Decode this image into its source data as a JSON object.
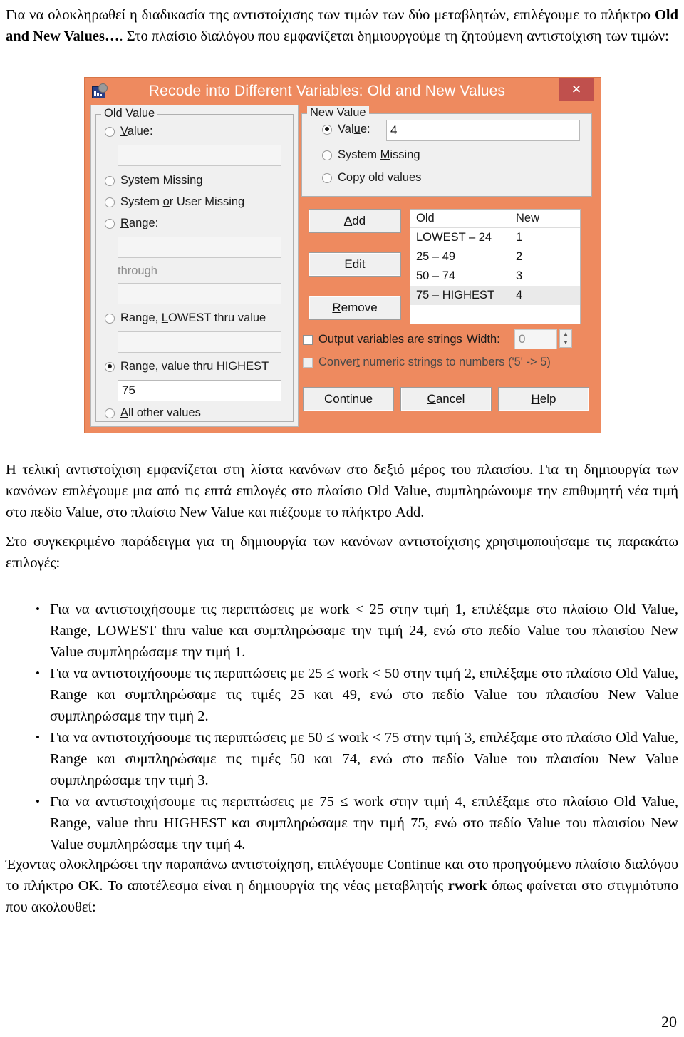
{
  "document": {
    "intro_paragraph_part1": "Για να ολοκληρωθεί η διαδικασία της αντιστοίχισης των τιμών των δύο μεταβλητών, επιλέγουμε το πλήκτρο ",
    "intro_paragraph_bold": "Old and New Values…",
    "intro_paragraph_part2": ". Στο πλαίσιο διαλόγου που εμφανίζεται δημιουργούμε τη ζητούμενη αντιστοίχιση των τιμών:",
    "mid_paragraph_1": "Η τελική αντιστοίχιση εμφανίζεται στη λίστα κανόνων στο δεξιό μέρος του πλαισίου. Για τη δημιουργία των κανόνων επιλέγουμε μια από τις επτά επιλογές στο πλαίσιο Old Value, συμπληρώνουμε την επιθυμητή νέα τιμή στο πεδίο Value, στο πλαίσιο New Value και πιέζουμε το πλήκτρο Add.",
    "mid_paragraph_2": "Στο συγκεκριμένο παράδειγμα για τη δημιουργία των κανόνων αντιστοίχισης χρησιμοποιήσαμε τις παρακάτω επιλογές:",
    "bullets": [
      "Για να αντιστοιχήσουμε τις περιπτώσεις με  work < 25 στην τιμή 1, επιλέξαμε στο πλαίσιο Old Value, Range, LOWEST thru value και συμπληρώσαμε την τιμή 24, ενώ στο πεδίο Value του πλαισίου New Value συμπληρώσαμε την τιμή 1.",
      "Για να αντιστοιχήσουμε τις περιπτώσεις με  25 ≤ work < 50 στην τιμή 2, επιλέξαμε στο πλαίσιο Old Value, Range και συμπληρώσαμε τις τιμές 25 και 49, ενώ στο πεδίο Value του πλαισίου New Value συμπληρώσαμε την τιμή 2.",
      "Για να αντιστοιχήσουμε τις περιπτώσεις με  50 ≤ work < 75 στην τιμή 3, επιλέξαμε στο πλαίσιο Old Value, Range και συμπληρώσαμε τις τιμές 50 και 74, ενώ στο πεδίο Value του πλαισίου New Value συμπληρώσαμε την τιμή 3.",
      "Για να αντιστοιχήσουμε τις περιπτώσεις με  75 ≤ work στην τιμή 4, επιλέξαμε στο πλαίσιο Old Value, Range, value thru HIGHEST και συμπληρώσαμε την τιμή 75, ενώ στο πεδίο Value του πλαισίου New Value συμπληρώσαμε την τιμή 4."
    ],
    "bullet_marker": "•",
    "closing_paragraph_part1": "Έχοντας ολοκληρώσει την παραπάνω αντιστοίχηση, επιλέγουμε Continue και στο προηγούμενο πλαίσιο διαλόγου το πλήκτρο ΟΚ. Το αποτέλεσμα είναι η δημιουργία της νέας μεταβλητής ",
    "closing_paragraph_bold": "rwork",
    "closing_paragraph_part2": " όπως φαίνεται στο στιγμιότυπο που ακολουθεί:",
    "page_number": "20"
  },
  "dialog": {
    "title": "Recode into Different Variables: Old and New Values",
    "close_label": "✕",
    "titlebar_color": "#ee8a5f",
    "close_button_color": "#c0504d",
    "old_value": {
      "group_title": "Old Value",
      "options": [
        {
          "label_pre": "",
          "label_underline": "V",
          "label_post": "alue:",
          "checked": false
        },
        {
          "label_pre": "",
          "label_underline": "S",
          "label_post": "ystem Missing",
          "checked": false
        },
        {
          "label_pre": "System ",
          "label_underline": "o",
          "label_post": "r User Missing",
          "checked": false
        },
        {
          "label_pre": "",
          "label_underline": "R",
          "label_post": "ange:",
          "checked": false
        },
        {
          "label_pre": "Range, ",
          "label_underline": "L",
          "label_post": "OWEST thru value",
          "checked": false
        },
        {
          "label_pre": "Range, value thru ",
          "label_underline": "H",
          "label_post": "IGHEST",
          "checked": true
        },
        {
          "label_pre": "",
          "label_underline": "A",
          "label_post": "ll other values",
          "checked": false
        }
      ],
      "value_input": "",
      "range_from_input": "",
      "through_label": "through",
      "range_to_input": "",
      "lowest_thru_input": "",
      "value_thru_highest_input": "75"
    },
    "new_value": {
      "group_title": "New Value",
      "options": [
        {
          "label_pre": "Val",
          "label_underline": "u",
          "label_post": "e:",
          "checked": true
        },
        {
          "label_pre": "System ",
          "label_underline": "M",
          "label_post": "issing",
          "checked": false
        },
        {
          "label_pre": "Cop",
          "label_underline": "y",
          "label_post": " old values",
          "checked": false
        }
      ],
      "value_input": "4"
    },
    "action_buttons": [
      {
        "label_underline": "A",
        "label_post": "dd"
      },
      {
        "label_underline": "E",
        "label_post": "dit"
      },
      {
        "label_underline": "R",
        "label_post": "emove"
      }
    ],
    "rules_list": {
      "header_old": "Old",
      "header_new": "New",
      "rows": [
        {
          "old": "LOWEST – 24",
          "new": "1",
          "selected": false
        },
        {
          "old": "25 – 49",
          "new": "2",
          "selected": false
        },
        {
          "old": "50 – 74",
          "new": "3",
          "selected": false
        },
        {
          "old": "75 – HIGHEST",
          "new": "4",
          "selected": true
        }
      ]
    },
    "output_strings": {
      "label_pre": "Output variables are ",
      "label_underline": "s",
      "label_post": "trings",
      "checked": false,
      "width_label": "Width:",
      "width_value": "0",
      "spinner_up": "▲",
      "spinner_down": "▼"
    },
    "convert_numeric": {
      "label_pre": "Conver",
      "label_underline": "t",
      "label_post": " numeric strings to numbers ('5' -> 5)",
      "checked": false,
      "disabled": true
    },
    "footer_buttons": [
      {
        "label_pre": "Continue",
        "label_underline": "",
        "label_post": ""
      },
      {
        "label_pre": "",
        "label_underline": "C",
        "label_post": "ancel"
      },
      {
        "label_pre": "",
        "label_underline": "H",
        "label_post": "elp"
      }
    ]
  }
}
